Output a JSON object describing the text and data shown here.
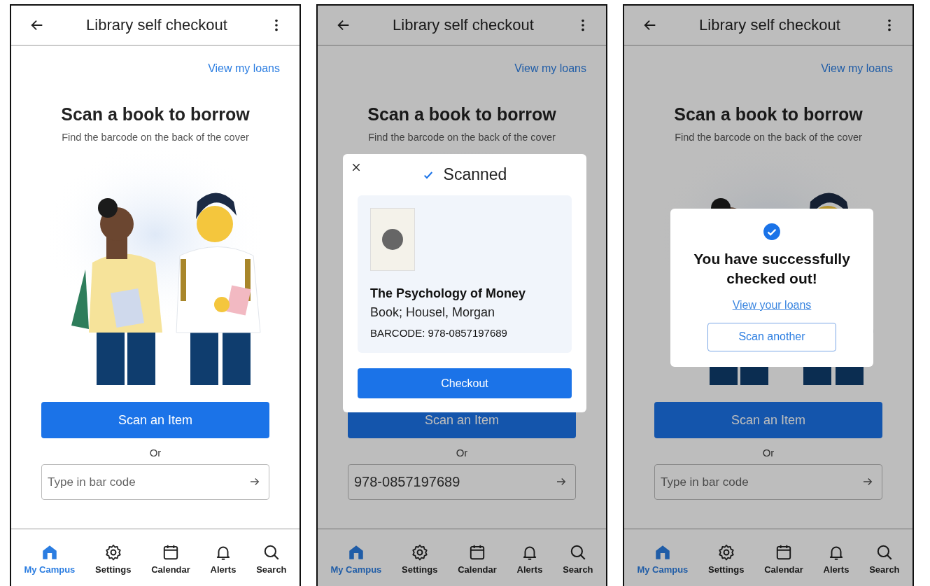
{
  "screens": [
    {
      "title": "Library self checkout",
      "link": "View my loans",
      "heading": "Scan a book to borrow",
      "subheading": "Find the barcode on the back of the cover",
      "scan_button": "Scan an Item",
      "or_label": "Or",
      "barcode_field": {
        "placeholder": "Type in bar code"
      },
      "dimmed": false,
      "nav": [
        {
          "label": "My Campus",
          "selected": true
        },
        {
          "label": "Settings",
          "selected": false
        },
        {
          "label": "Calendar",
          "selected": false
        },
        {
          "label": "Alerts",
          "selected": false
        },
        {
          "label": "Search",
          "selected": false
        }
      ]
    },
    {
      "title": "Library self checkout",
      "link": "View my loans",
      "heading": "Scan a book to borrow",
      "subheading": "Find the barcode on the back of the cover",
      "scan_button": "Scan an Item",
      "or_label": "Or",
      "barcode_field": {
        "value": "978-0857197689"
      },
      "dimmed": true,
      "nav": [
        {
          "label": "My Campus",
          "selected": true
        },
        {
          "label": "Settings",
          "selected": false
        },
        {
          "label": "Calendar",
          "selected": false
        },
        {
          "label": "Alerts",
          "selected": false
        },
        {
          "label": "Search",
          "selected": false
        }
      ],
      "dialog": {
        "kind": "scanned",
        "title": "Scanned",
        "item_title": "The Psychology of Money",
        "item_meta": "Book; Housel, Morgan",
        "item_barcode": "BARCODE: 978-0857197689",
        "button": "Checkout"
      }
    },
    {
      "title": "Library self checkout",
      "link": "View my loans",
      "heading": "Scan a book to borrow",
      "subheading": "Find the barcode on the back of the cover",
      "scan_button": "Scan an Item",
      "or_label": "Or",
      "barcode_field": {
        "placeholder": "Type in bar code"
      },
      "dimmed": true,
      "nav": [
        {
          "label": "My Campus",
          "selected": true
        },
        {
          "label": "Settings",
          "selected": false
        },
        {
          "label": "Calendar",
          "selected": false
        },
        {
          "label": "Alerts",
          "selected": false
        },
        {
          "label": "Search",
          "selected": false
        }
      ],
      "dialog": {
        "kind": "success",
        "message": "You have successfully checked out!",
        "link": "View your loans",
        "button": "Scan another"
      }
    }
  ]
}
